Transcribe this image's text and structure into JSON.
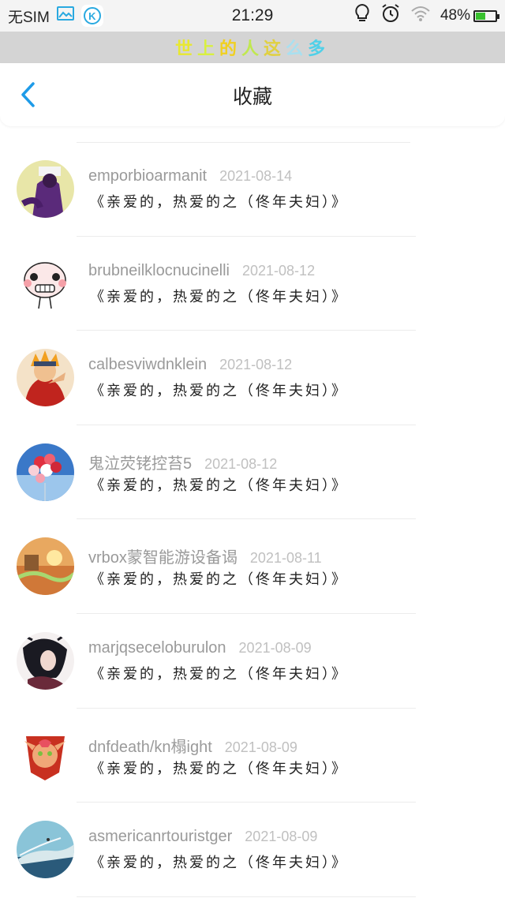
{
  "status_bar": {
    "carrier": "无SIM",
    "time": "21:29",
    "battery": "48%",
    "battery_level": 0.48,
    "app_badge": "K",
    "icons": [
      "image-icon",
      "k-app-icon",
      "bulb-icon",
      "alarm-icon",
      "wifi-icon",
      "battery-icon"
    ]
  },
  "banner": {
    "chars": [
      "世",
      "上",
      "的",
      "人",
      "这",
      "么",
      "多"
    ],
    "colors": [
      "#e8e830",
      "#d8f040",
      "#f0d020",
      "#c0e850",
      "#e0d040",
      "#a8e0f0",
      "#50d0e8"
    ]
  },
  "nav": {
    "title": "收藏",
    "back_icon": "chevron-left-icon",
    "accent": "#1e9be8"
  },
  "items": [
    {
      "user": "emporbioarmanit",
      "date": "2021-08-14",
      "title": "《亲爱的，热爱的之（佟年夫妇）》",
      "avatar": "avatar-purple"
    },
    {
      "user": "brubneilklocnucinelli",
      "date": "2021-08-12",
      "title": "《亲爱的，热爱的之（佟年夫妇）》",
      "avatar": "avatar-cartoon"
    },
    {
      "user": "calbesviwdnklein",
      "date": "2021-08-12",
      "title": "《亲爱的，热爱的之（佟年夫妇）》",
      "avatar": "avatar-anime-red"
    },
    {
      "user": "鬼泣荧铑控苔5",
      "date": "2021-08-12",
      "title": "《亲爱的，热爱的之（佟年夫妇）》",
      "avatar": "avatar-balloons"
    },
    {
      "user": "vrbox蒙智能游设备谒",
      "date": "2021-08-11",
      "title": "《亲爱的，热爱的之（佟年夫妇）》",
      "avatar": "avatar-sunset"
    },
    {
      "user": "marjqseceloburulon",
      "date": "2021-08-09",
      "title": "《亲爱的，热爱的之（佟年夫妇）》",
      "avatar": "avatar-dark"
    },
    {
      "user": "dnfdeath/kn榻ight",
      "date": "2021-08-09",
      "title": "《亲爱的，热爱的之（佟年夫妇）》",
      "avatar": "avatar-emblem"
    },
    {
      "user": "asmericanrtouristger",
      "date": "2021-08-09",
      "title": "《亲爱的，热爱的之（佟年夫妇）》",
      "avatar": "avatar-ocean"
    }
  ]
}
